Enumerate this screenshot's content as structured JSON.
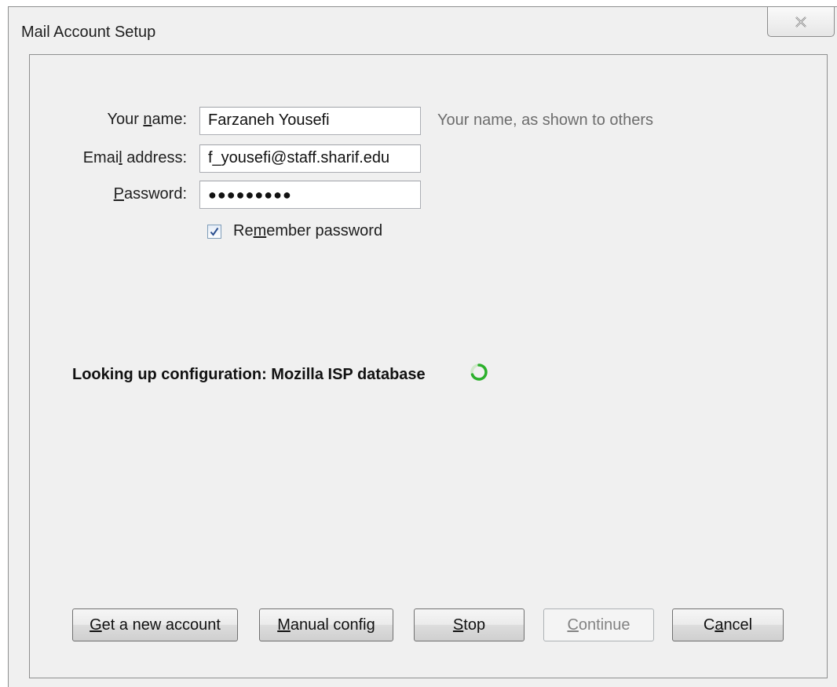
{
  "window": {
    "title": "Mail Account Setup"
  },
  "form": {
    "name": {
      "label_pre": "Your ",
      "label_key": "n",
      "label_post": "ame:",
      "value": "Farzaneh Yousefi",
      "hint": "Your name, as shown to others"
    },
    "email": {
      "label_pre": "Emai",
      "label_key": "l",
      "label_post": " address:",
      "value": "f_yousefi@staff.sharif.edu"
    },
    "password": {
      "label_pre": "",
      "label_key": "P",
      "label_post": "assword:",
      "value": "●●●●●●●●●"
    },
    "remember": {
      "label_pre": "Re",
      "label_key": "m",
      "label_post": "ember password",
      "checked": true
    }
  },
  "status": {
    "text": "Looking up configuration: Mozilla ISP database",
    "spinner_color": "#2bb02b"
  },
  "buttons": {
    "new_account": {
      "pre": "",
      "key": "G",
      "post": "et a new account"
    },
    "manual_config": {
      "pre": "",
      "key": "M",
      "post": "anual config"
    },
    "stop": {
      "pre": "",
      "key": "S",
      "post": "top"
    },
    "continue": {
      "pre": "",
      "key": "C",
      "post": "ontinue",
      "disabled": true
    },
    "cancel": {
      "pre": "C",
      "key": "a",
      "post": "ncel"
    }
  },
  "icons": {
    "close": "close-icon",
    "checkbox_check": "checkmark-icon",
    "spinner": "loading-spinner-icon"
  }
}
